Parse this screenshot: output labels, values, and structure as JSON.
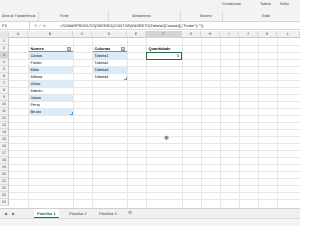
{
  "ribbon": {
    "top_items": [
      "Condicional",
      "Tabela",
      "Estilo"
    ],
    "groups": [
      "Área de Transferência",
      "Fonte",
      "Alinhamento",
      "Número",
      "Estilo"
    ]
  },
  "formula_bar": {
    "name_box": "F3",
    "formula": "=SOMARPRODUTO(SEERRO(CONT.SE(INDIRETO(Tabela1[Coluna1]),\"Foxter\");\"\"))"
  },
  "columns": [
    "A",
    "B",
    "C",
    "D",
    "E",
    "F",
    "G",
    "H",
    "I",
    "J",
    "K",
    "L",
    "M",
    "N",
    "O",
    "P"
  ],
  "selected_column": "F",
  "rows": [
    "1",
    "2",
    "3",
    "4",
    "5",
    "6",
    "7",
    "8",
    "9",
    "10",
    "11",
    "12",
    "13",
    "14",
    "15",
    "16",
    "17",
    "18",
    "19",
    "20",
    "21",
    "22",
    "23",
    "24"
  ],
  "selected_row": "3",
  "nomes_table": {
    "header": "Nomes",
    "items": [
      "Carlos",
      "Foxter",
      "Mike",
      "Milena",
      "Victor",
      "Márcio",
      "Jason",
      "Perry",
      "Bruno"
    ]
  },
  "colunas_table": {
    "header": "Colunas",
    "items": [
      "Tabela1",
      "Tabela2",
      "Tabela3",
      "Tabela4"
    ]
  },
  "quantidade": {
    "header": "Quantidade",
    "value": "3"
  },
  "sheets": [
    "Planilha 1",
    "Planilha 2",
    "Planilha 3"
  ],
  "active_sheet": "Planilha 1"
}
